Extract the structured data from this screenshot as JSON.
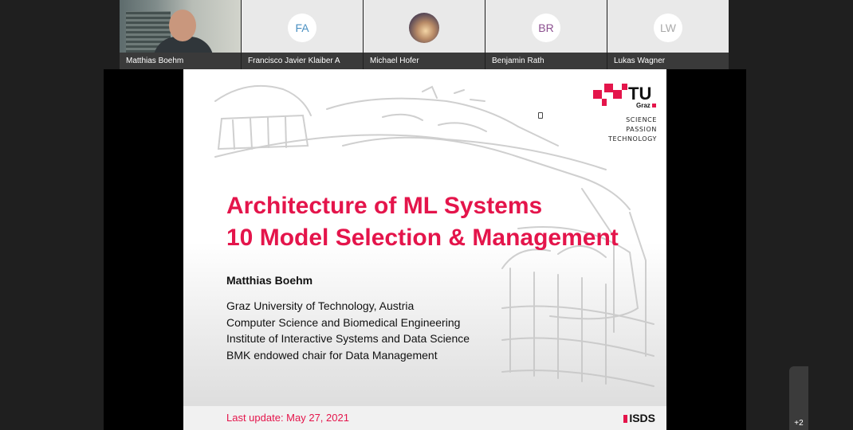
{
  "participants": [
    {
      "name": "Matthias Boehm",
      "video": true
    },
    {
      "name": "Francisco Javier Klaiber A",
      "initials": "FA",
      "color": "#4a90c2"
    },
    {
      "name": "Michael Hofer",
      "avatar": true
    },
    {
      "name": "Benjamin Rath",
      "initials": "BR",
      "color": "#8b4f8f"
    },
    {
      "name": "Lukas Wagner",
      "initials": "LW",
      "color": "#aaaaaa"
    }
  ],
  "slide": {
    "title_line1": "Architecture of ML Systems",
    "title_line2": "10 Model Selection & Management",
    "author": "Matthias Boehm",
    "affiliation": [
      "Graz University of Technology, Austria",
      "Computer Science and Biomedical Engineering",
      "Institute of Interactive Systems and Data Science",
      "BMK endowed chair for Data Management"
    ],
    "last_update": "Last update: May 27, 2021",
    "logo": {
      "tu": "TU",
      "graz": "Graz",
      "tagline": [
        "SCIENCE",
        "PASSION",
        "TECHNOLOGY"
      ]
    },
    "footer_logo": "ISDS"
  },
  "overflow_count": "+2",
  "colors": {
    "accent": "#e4154b"
  }
}
